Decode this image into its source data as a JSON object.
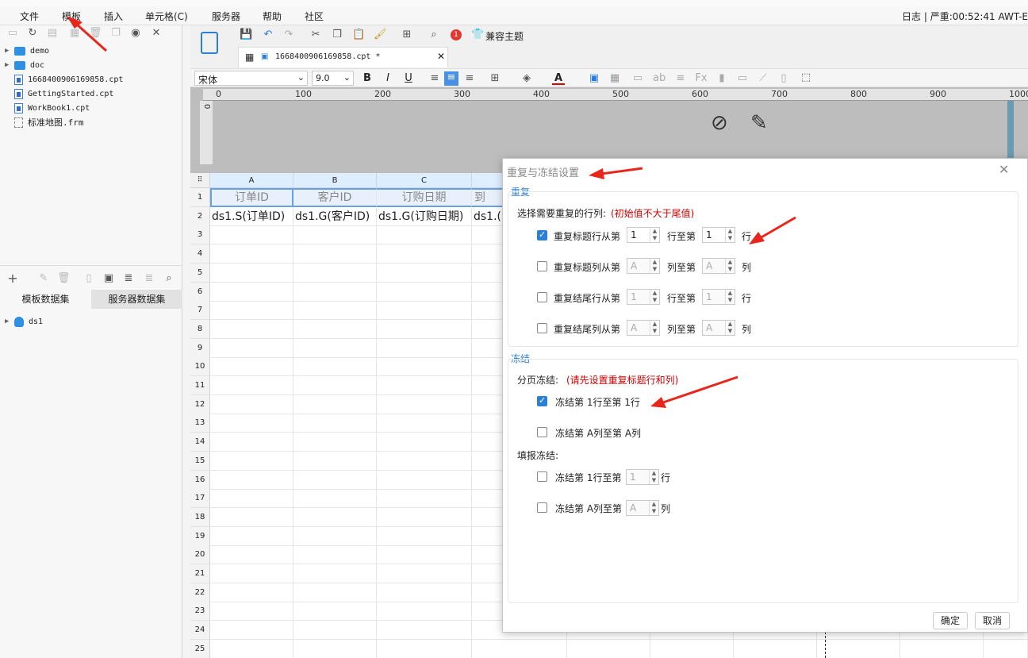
{
  "menubar": {
    "items": [
      "文件",
      "模板",
      "插入",
      "单元格(C)",
      "服务器",
      "帮助",
      "社区"
    ],
    "status": "日志 | 严重:00:52:41 AWT-E"
  },
  "tree": {
    "items": [
      {
        "label": "demo",
        "type": "folder"
      },
      {
        "label": "doc",
        "type": "folder"
      },
      {
        "label": "1668400906169858.cpt",
        "type": "cpt"
      },
      {
        "label": "GettingStarted.cpt",
        "type": "cpt"
      },
      {
        "label": "WorkBook1.cpt",
        "type": "cpt"
      },
      {
        "label": "标准地图.frm",
        "type": "frm"
      }
    ]
  },
  "dataset_tabs": [
    "模板数据集",
    "服务器数据集"
  ],
  "dataset_tree": [
    "ds1"
  ],
  "editor": {
    "tab_title": "1668400906169858.cpt *",
    "compat_theme": "兼容主题",
    "badge": "1",
    "font": "宋体",
    "font_size": "9.0"
  },
  "ruler_labels": [
    "0",
    "100",
    "200",
    "300",
    "400",
    "500",
    "600",
    "700",
    "800",
    "900",
    "1000"
  ],
  "grid": {
    "columns": [
      "A",
      "B",
      "C"
    ],
    "row_numbers": [
      "1",
      "2",
      "3",
      "4",
      "5",
      "6",
      "7",
      "8",
      "9",
      "10",
      "11",
      "12",
      "13",
      "14",
      "15",
      "16",
      "17",
      "18",
      "19",
      "20",
      "21",
      "22",
      "23",
      "24",
      "25"
    ],
    "row1": [
      "订单ID",
      "客户ID",
      "订购日期",
      "到"
    ],
    "row2": [
      "ds1.S(订单ID)",
      "ds1.G(客户ID)",
      "ds1.G(订购日期)",
      "ds1.("
    ]
  },
  "dialog": {
    "title": "重复与冻结设置",
    "repeat": {
      "section": "重复",
      "prompt": "选择需要重复的行列:",
      "prompt_hint": "(初始值不大于尾值)",
      "rows": [
        {
          "label": "重复标题行从第",
          "from": "1",
          "mid": "行至第",
          "to": "1",
          "end": "行",
          "checked": true
        },
        {
          "label": "重复标题列从第",
          "from": "A",
          "mid": "列至第",
          "to": "A",
          "end": "列",
          "checked": false
        },
        {
          "label": "重复结尾行从第",
          "from": "1",
          "mid": "行至第",
          "to": "1",
          "end": "行",
          "checked": false
        },
        {
          "label": "重复结尾列从第",
          "from": "A",
          "mid": "列至第",
          "to": "A",
          "end": "列",
          "checked": false
        }
      ]
    },
    "freeze": {
      "section": "冻结",
      "page_label": "分页冻结:",
      "page_hint": "(请先设置重复标题行和列)",
      "page_rows": [
        {
          "label": "冻结第 1行至第 1行",
          "checked": true
        },
        {
          "label": "冻结第 A列至第 A列",
          "checked": false
        }
      ],
      "fill_label": "填报冻结:",
      "fill_rows": [
        {
          "label": "冻结第 1行至第",
          "value": "1",
          "end": "行",
          "checked": false
        },
        {
          "label": "冻结第 A列至第",
          "value": "A",
          "end": "列",
          "checked": false
        }
      ]
    },
    "ok": "确定",
    "cancel": "取消"
  }
}
